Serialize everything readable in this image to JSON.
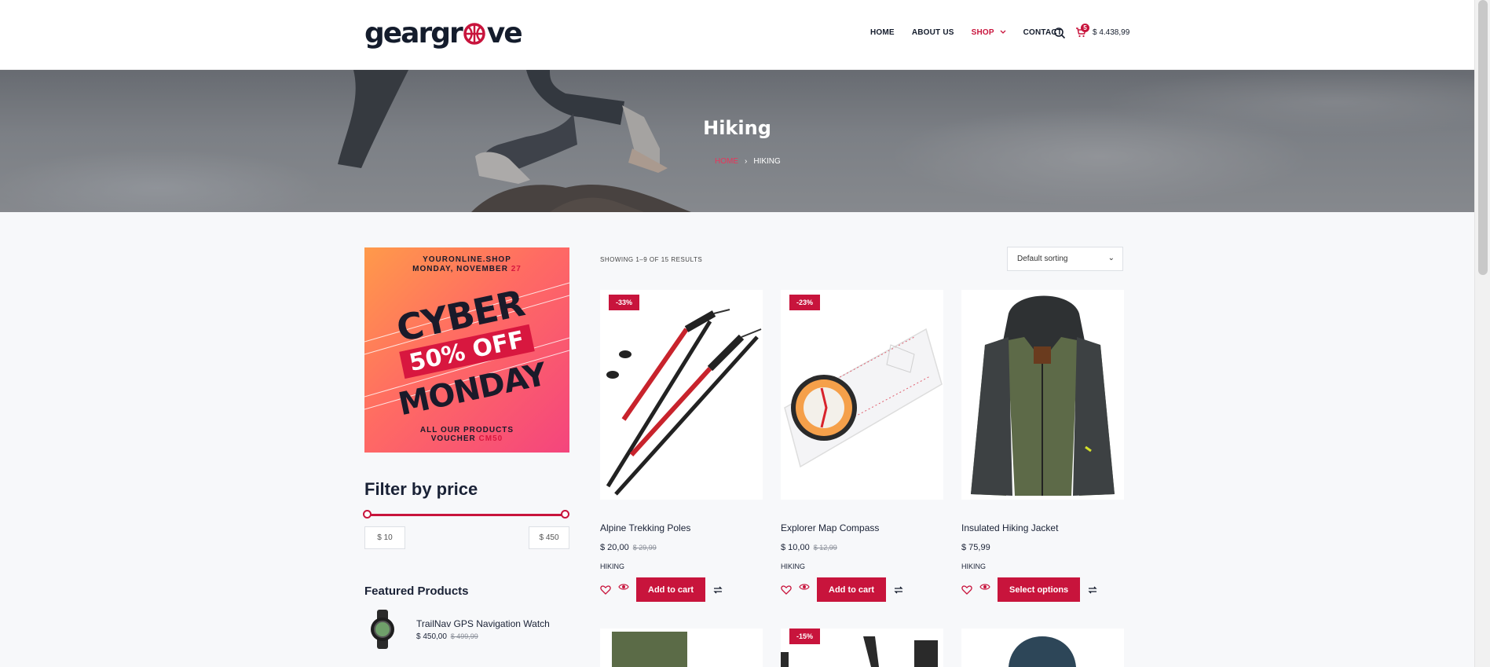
{
  "header": {
    "logo_text_left": "geargr",
    "logo_text_ball": "⊕",
    "logo_text_right": "ve",
    "nav": [
      "HOME",
      "ABOUT US",
      "SHOP",
      "CONTACT"
    ],
    "cart_count": "5",
    "cart_total": "$ 4.438,99"
  },
  "hero": {
    "title": "Hiking",
    "breadcrumb_home": "HOME",
    "breadcrumb_sep": "›",
    "breadcrumb_current": "HIKING"
  },
  "banner": {
    "line1": "YOURONLINE.SHOP",
    "line2a": "MONDAY, NOVEMBER ",
    "line2b": "27",
    "cyber": "CYBER",
    "off": "50% OFF",
    "monday": "MONDAY",
    "bottom1": "ALL OUR PRODUCTS",
    "bottom2a": "VOUCHER ",
    "bottom2b": "CM50"
  },
  "filter": {
    "title": "Filter by price",
    "min": "$ 10",
    "max": "$ 450",
    "min_fraction": 0.0,
    "max_fraction": 1.0
  },
  "featured": {
    "title": "Featured Products",
    "items": [
      {
        "name": "TrailNav GPS Navigation Watch",
        "price": "$ 450,00",
        "old_price": "$ 499,99"
      }
    ]
  },
  "shop": {
    "result_count": "SHOWING 1–9 OF 15 RESULTS",
    "sorting": "Default sorting",
    "sorting_chevron": "⌄"
  },
  "products": [
    {
      "name": "Alpine Trekking Poles",
      "price": "$ 20,00",
      "old_price": "$ 29,99",
      "badge": "-33%",
      "category": "HIKING",
      "button": "Add to cart"
    },
    {
      "name": "Explorer Map Compass",
      "price": "$ 10,00",
      "old_price": "$ 12,99",
      "badge": "-23%",
      "category": "HIKING",
      "button": "Add to cart"
    },
    {
      "name": "Insulated Hiking Jacket",
      "price": "$ 75,99",
      "old_price": "",
      "badge": "",
      "category": "HIKING",
      "button": "Select options"
    }
  ],
  "next_row": [
    {
      "badge": ""
    },
    {
      "badge": "-15%"
    },
    {
      "badge": ""
    }
  ],
  "colors": {
    "accent": "#c8143c",
    "dark": "#1a2236"
  }
}
